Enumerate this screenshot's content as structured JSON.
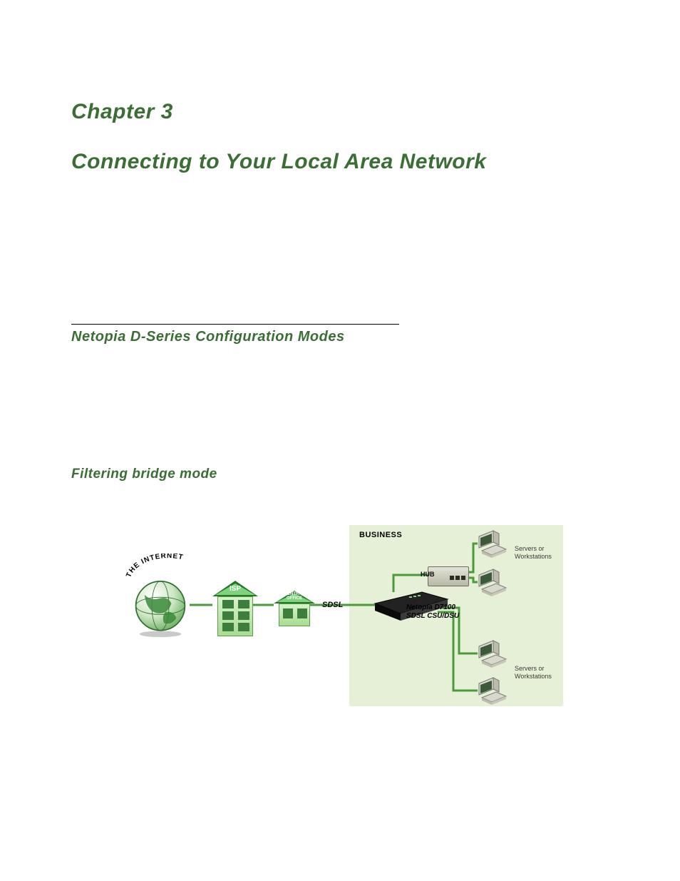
{
  "headings": {
    "chapter": "Chapter 3",
    "title": "Connecting to Your Local Area Network",
    "section": "Netopia D-Series Configuration Modes",
    "subsection": "Filtering bridge mode"
  },
  "diagram": {
    "arc_text": "THE INTERNET",
    "isp_label": "ISP",
    "central_office_label_1": "CENTRAL",
    "central_office_label_2": "OFFICE",
    "sdsl_label": "SDSL",
    "business_label": "BUSINESS",
    "hub_label": "HUB",
    "device_label_1": "Netopia D7100",
    "device_label_2": "SDSL CSU/DSU",
    "workstation_caption": "Servers or Workstations"
  },
  "colors": {
    "heading_green": "#3a6e34",
    "panel_green": "#e6f0d6",
    "link_green": "#4a9a3a"
  }
}
